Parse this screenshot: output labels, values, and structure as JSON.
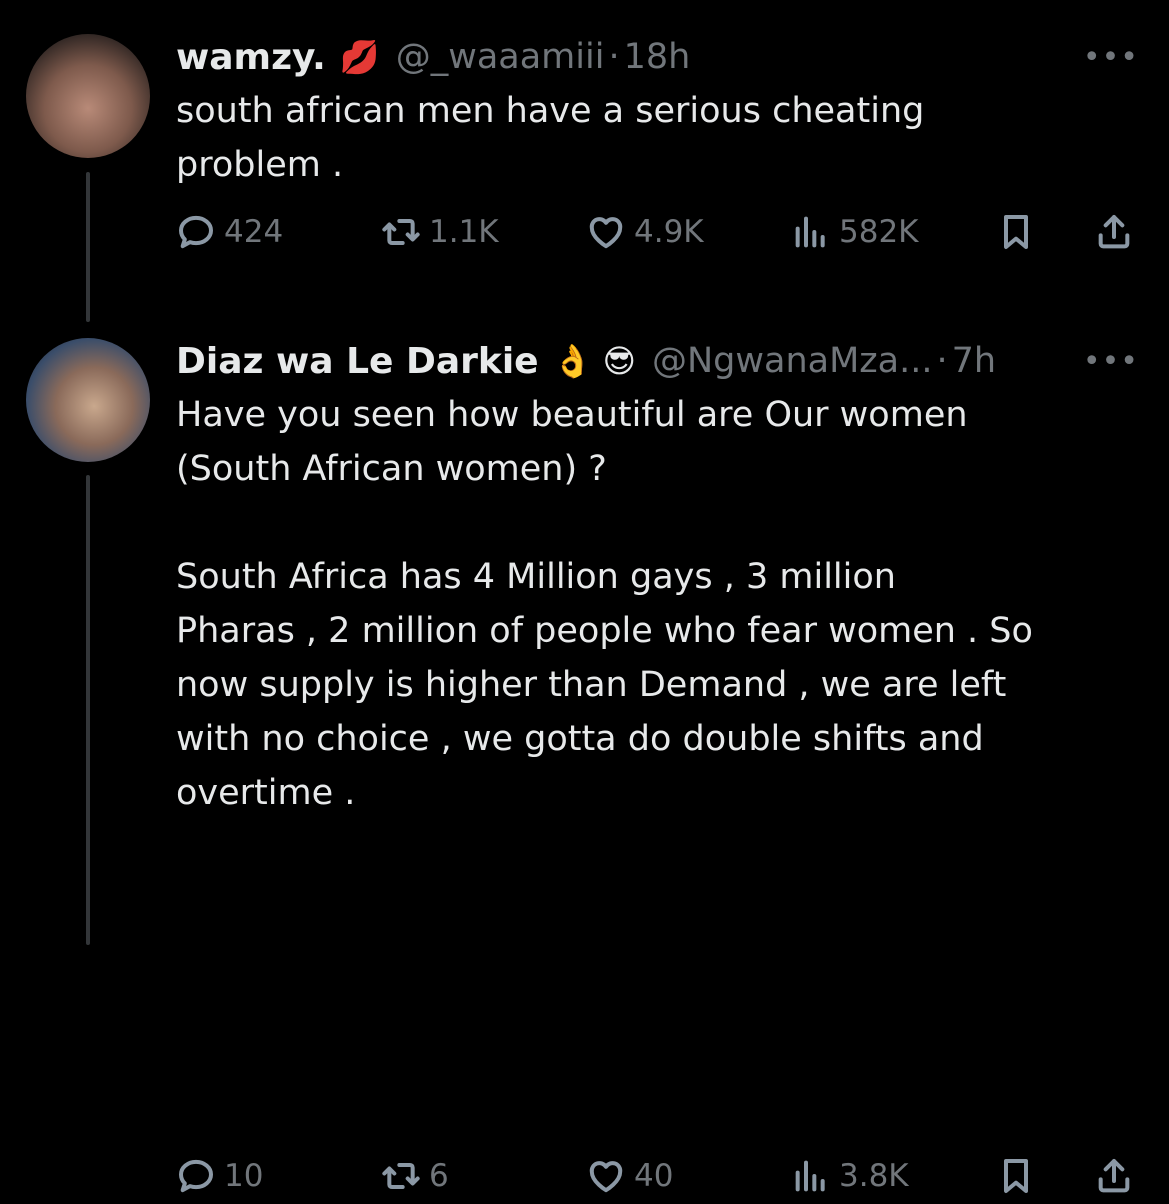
{
  "tweets": [
    {
      "name": "wamzy.",
      "name_emoji": "💋",
      "handle": "@_waaamiii",
      "separator": "·",
      "time": "18h",
      "more": "•••",
      "text": "south african men have a serious cheating\nproblem .",
      "replies": "424",
      "retweets": "1.1K",
      "likes": "4.9K",
      "views": "582K"
    },
    {
      "name": "Diaz wa Le Darkie",
      "name_emoji": "👌 😎",
      "handle": "@NgwanaMza...",
      "separator": "·",
      "time": "7h",
      "more": "•••",
      "text": "Have you seen how beautiful are Our women\n(South African women) ?\n\nSouth Africa has 4 Million gays , 3 million\nPharas , 2 million of people who fear women . So\nnow supply is higher than Demand , we are left\nwith no choice , we gotta do double shifts and\novertime .",
      "replies": "10",
      "retweets": "6",
      "likes": "40",
      "views": "3.8K"
    }
  ],
  "colors": {
    "background": "#000000",
    "text": "#e7e9ea",
    "muted": "#71767b",
    "thread_line": "#333639"
  }
}
